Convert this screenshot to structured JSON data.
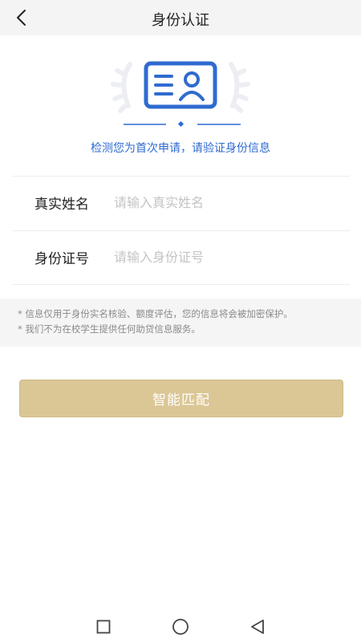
{
  "header": {
    "title": "身份认证",
    "back_icon": "chevron-left-icon"
  },
  "hero": {
    "icon": "id-card-icon",
    "accent_color": "#2f6bd0",
    "message": "检测您为首次申请，请验证身份信息"
  },
  "form": {
    "name": {
      "label": "真实姓名",
      "placeholder": "请输入真实姓名",
      "value": ""
    },
    "id_number": {
      "label": "身份证号",
      "placeholder": "请输入身份证号",
      "value": ""
    }
  },
  "notice": {
    "line1": "* 信息仅用于身份实名核验、额度评估，您的信息将会被加密保护。",
    "line2": "* 我们不为在校学生提供任何助贷信息服务。"
  },
  "actions": {
    "match_label": "智能匹配",
    "button_color": "#dbc695"
  },
  "navbar": {
    "recent_icon": "square-icon",
    "home_icon": "circle-icon",
    "back_icon": "triangle-back-icon"
  }
}
